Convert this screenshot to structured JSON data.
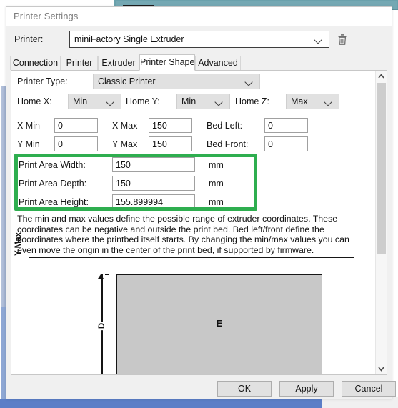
{
  "window": {
    "title": "Printer Settings"
  },
  "printer_row": {
    "label": "Printer:",
    "selected": "miniFactory Single Extruder",
    "delete_icon": "trash-icon"
  },
  "tabs": [
    {
      "label": "Connection",
      "active": false
    },
    {
      "label": "Printer",
      "active": false
    },
    {
      "label": "Extruder",
      "active": false
    },
    {
      "label": "Printer Shape",
      "active": true
    },
    {
      "label": "Advanced",
      "active": false
    }
  ],
  "form": {
    "printer_type": {
      "label": "Printer Type:",
      "value": "Classic Printer"
    },
    "home_x": {
      "label": "Home X:",
      "value": "Min"
    },
    "home_y": {
      "label": "Home Y:",
      "value": "Min"
    },
    "home_z": {
      "label": "Home Z:",
      "value": "Max"
    },
    "x_min": {
      "label": "X Min",
      "value": "0"
    },
    "x_max": {
      "label": "X Max",
      "value": "150"
    },
    "bed_left": {
      "label": "Bed Left:",
      "value": "0"
    },
    "y_min": {
      "label": "Y Min",
      "value": "0"
    },
    "y_max": {
      "label": "Y Max",
      "value": "150"
    },
    "bed_front": {
      "label": "Bed Front:",
      "value": "0"
    },
    "print_area_width": {
      "label": "Print Area Width:",
      "value": "150",
      "unit": "mm"
    },
    "print_area_depth": {
      "label": "Print Area Depth:",
      "value": "150",
      "unit": "mm"
    },
    "print_area_height": {
      "label": "Print Area Height:",
      "value": "155.899994",
      "unit": "mm"
    }
  },
  "annotation": {
    "highlight_color": "#2eae4f"
  },
  "description": "The min and max values define the possible range of extruder coordinates. These coordinates can be negative and outside the print bed. Bed left/front define the coordinates where the printbed itself starts. By changing the min/max values you can even move the origin in the center of the print bed, if supported by firmware.",
  "preview": {
    "axis_label": "Y Max",
    "dimension_label": "D",
    "bed_label": "E"
  },
  "scrollbar": {
    "up_icon": "chevron-up-icon",
    "down_icon": "chevron-down-icon"
  },
  "buttons": {
    "ok": "OK",
    "apply": "Apply",
    "cancel": "Cancel"
  }
}
